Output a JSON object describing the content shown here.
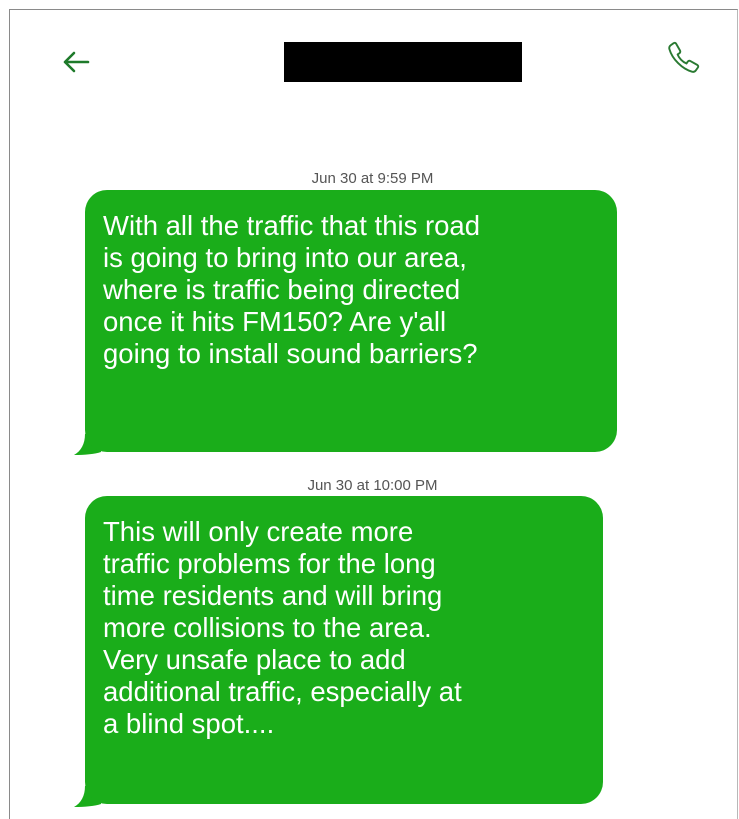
{
  "header": {
    "back_icon": "arrow-left-icon",
    "contact_name": "",
    "contact_name_redacted": true,
    "call_icon": "phone-icon",
    "accent_color": "#1e8b1e"
  },
  "messages": [
    {
      "timestamp": "Jun 30 at 9:59 PM",
      "text": "With all the traffic that this road\nis going to bring into our area,\nwhere is traffic being directed\nonce it hits FM150? Are y'all\ngoing to install sound barriers?",
      "bubble_color": "#1aad1a"
    },
    {
      "timestamp": "Jun 30 at 10:00 PM",
      "text": "This will only create more\ntraffic problems for the long\ntime residents and will bring\nmore collisions to the area.\nVery unsafe place to add\nadditional traffic, especially at\na blind spot....",
      "bubble_color": "#1aad1a"
    }
  ]
}
